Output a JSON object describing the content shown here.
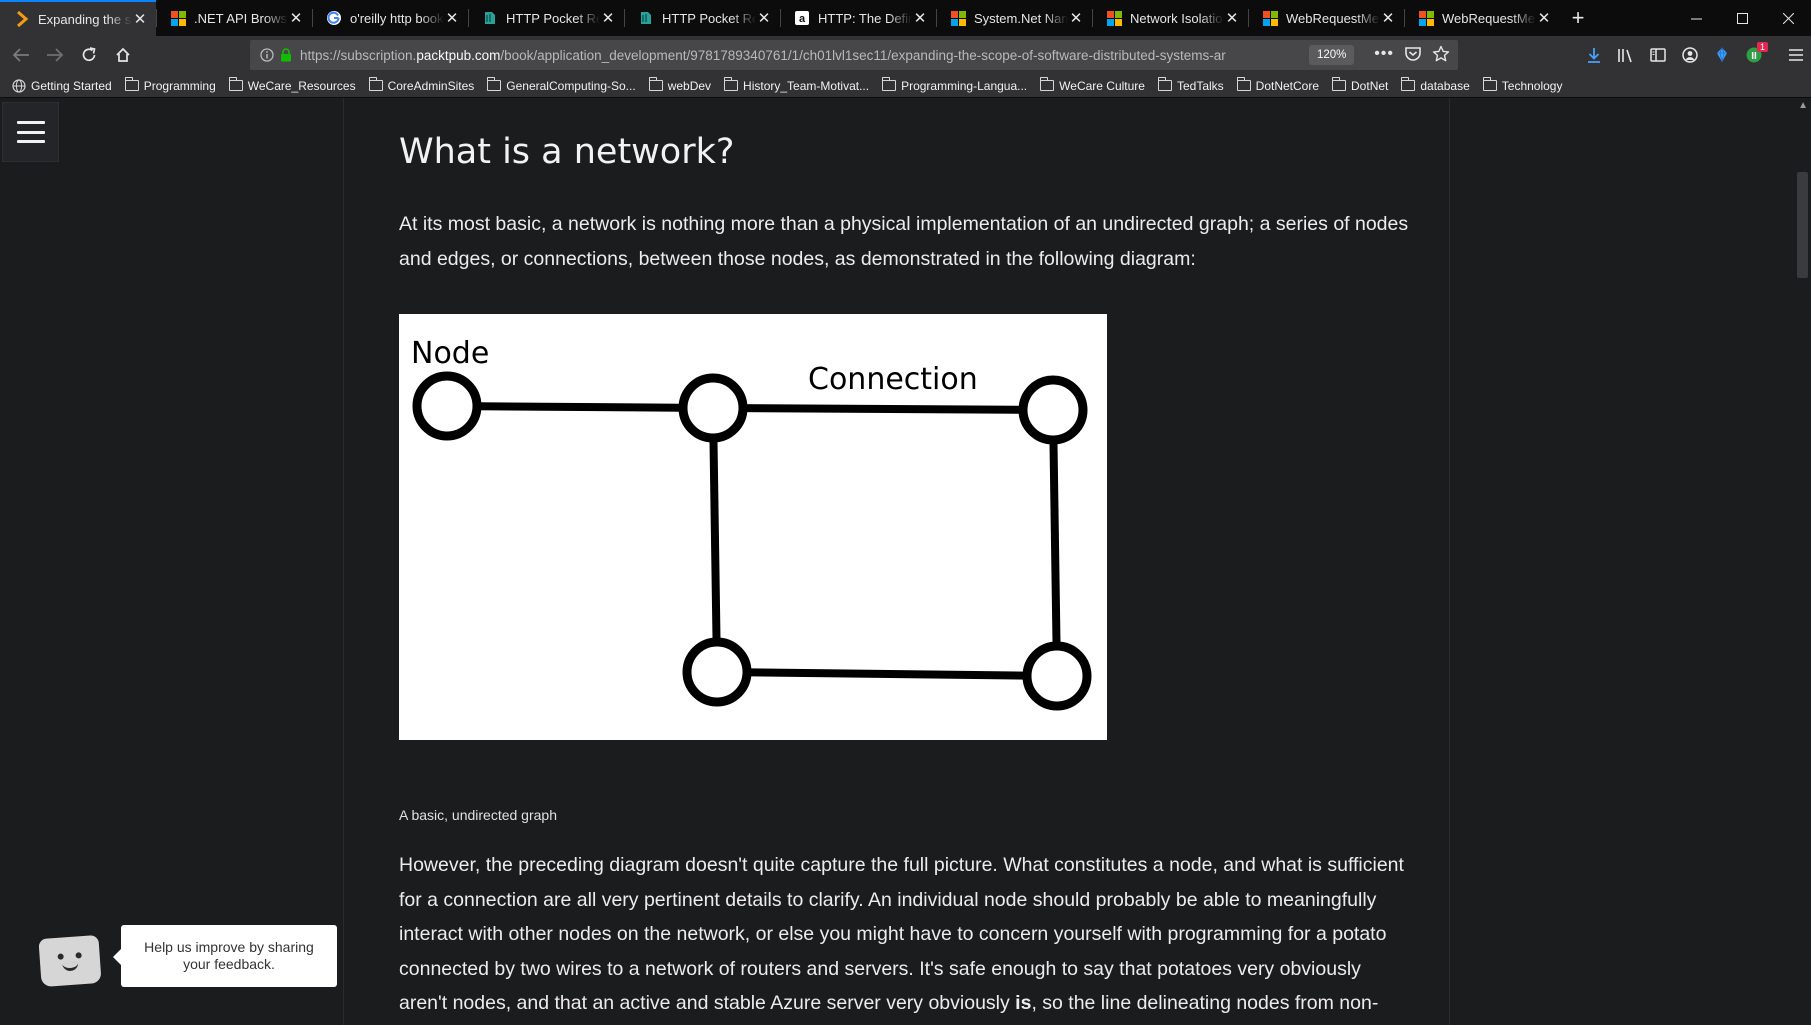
{
  "tabs": [
    {
      "title": "Expanding the sco",
      "icon": "packt-icon",
      "active": true
    },
    {
      "title": ".NET API Browser",
      "icon": "microsoft-icon",
      "active": false
    },
    {
      "title": "o'reilly http book",
      "icon": "google-icon",
      "active": false
    },
    {
      "title": "HTTP Pocket Refe",
      "icon": "oreilly-icon",
      "active": false
    },
    {
      "title": "HTTP Pocket Refe",
      "icon": "oreilly-icon",
      "active": false
    },
    {
      "title": "HTTP: The Definiti",
      "icon": "amazon-icon",
      "active": false
    },
    {
      "title": "System.Net Name",
      "icon": "microsoft-icon",
      "active": false
    },
    {
      "title": "Network Isolation",
      "icon": "microsoft-icon",
      "active": false
    },
    {
      "title": "WebRequestMeth",
      "icon": "microsoft-icon",
      "active": false
    },
    {
      "title": "WebRequestMeth",
      "icon": "microsoft-icon",
      "active": false
    }
  ],
  "navbar": {
    "url_prefix": "https://subscription.",
    "url_host": "packtpub.com",
    "url_path": "/book/application_development/9781789340761/1/ch01lvl1sec11/expanding-the-scope-of-software-distributed-systems-ar",
    "zoom": "120%",
    "download_badge": "1"
  },
  "bookmarks": [
    {
      "label": "Getting Started",
      "type": "globe"
    },
    {
      "label": "Programming",
      "type": "folder"
    },
    {
      "label": "WeCare_Resources",
      "type": "folder"
    },
    {
      "label": "CoreAdminSites",
      "type": "folder"
    },
    {
      "label": "GeneralComputing-So...",
      "type": "folder"
    },
    {
      "label": "webDev",
      "type": "folder"
    },
    {
      "label": "History_Team-Motivat...",
      "type": "folder"
    },
    {
      "label": "Programming-Langua...",
      "type": "folder"
    },
    {
      "label": "WeCare Culture",
      "type": "folder"
    },
    {
      "label": "TedTalks",
      "type": "folder"
    },
    {
      "label": "DotNetCore",
      "type": "folder"
    },
    {
      "label": "DotNet",
      "type": "folder"
    },
    {
      "label": "database",
      "type": "folder"
    },
    {
      "label": "Technology",
      "type": "folder"
    }
  ],
  "article": {
    "heading": "What is a network?",
    "para1": "At its most basic, a network is nothing more than a physical implementation of an undirected graph; a series of nodes and edges, or connections, between those nodes, as demonstrated in the following diagram:",
    "figure": {
      "node_label": "Node",
      "connection_label": "Connection"
    },
    "caption": "A basic, undirected graph",
    "para2_before_bold": "However, the preceding diagram doesn't quite capture the full picture. What constitutes a node, and what is sufficient for a connection are all very pertinent details to clarify. An individual node should probably be able to meaningfully interact with other nodes on the network, or else you might have to concern yourself with programming for a potato connected by two wires to a network of routers and servers. It's safe enough to say that potatoes very obviously aren't nodes, and that an active and stable Azure server very obviously ",
    "para2_bold": "is",
    "para2_after_bold": ", so the line delineating nodes from non-nodes on a"
  },
  "feedback": {
    "tooltip": "Help us improve by sharing your feedback."
  }
}
